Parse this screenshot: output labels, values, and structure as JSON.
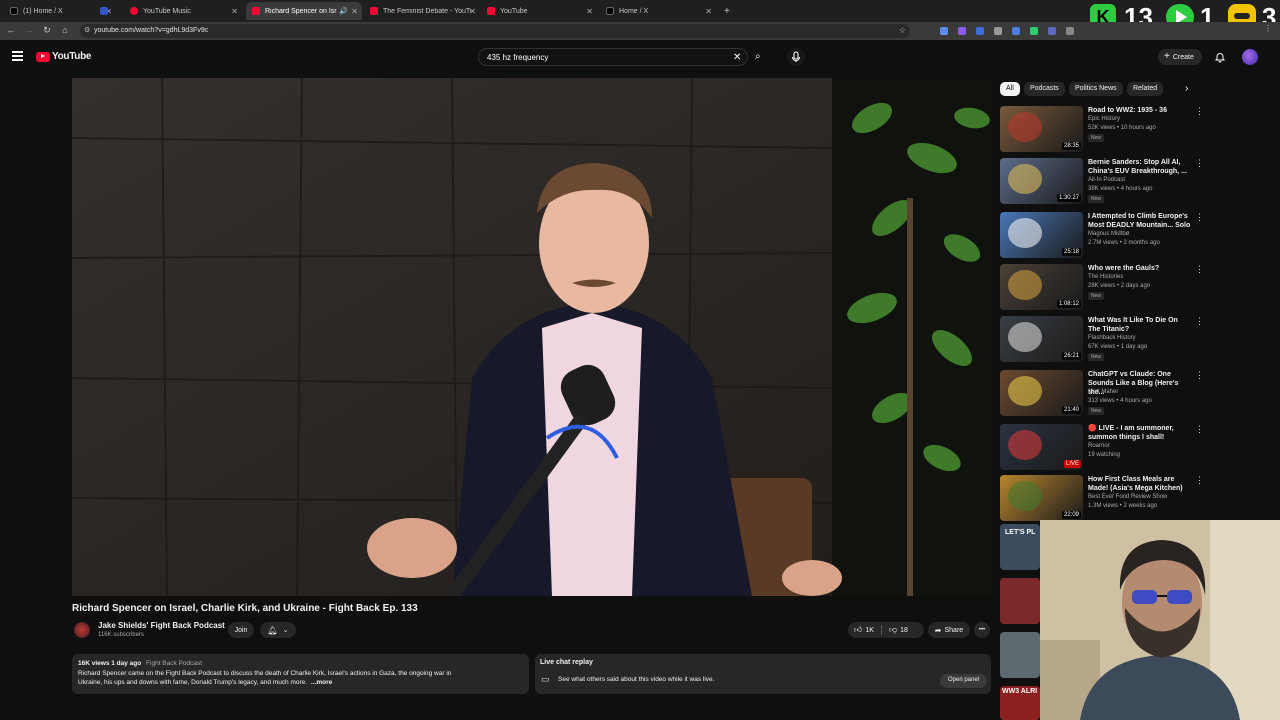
{
  "tabs": [
    {
      "label": "(1) Home / X",
      "fav_color": "#000000"
    },
    {
      "label": "",
      "fav_color": "#1d4ed8"
    },
    {
      "label": "YouTube Music",
      "fav_color": "#ff0033"
    },
    {
      "label": "Richard Spencer on Israel, C",
      "fav_color": "#ff0033"
    },
    {
      "label": "The Feminist Debate - YouTube",
      "fav_color": "#ff0033"
    },
    {
      "label": "YouTube",
      "fav_color": "#ff0033"
    },
    {
      "label": "Home / X",
      "fav_color": "#000000"
    }
  ],
  "new_tab": "+",
  "address": {
    "url": "youtube.com/watch?v=gdhL9d3Fv9c"
  },
  "overlay": {
    "count_a": "13",
    "count_b": "1",
    "count_c": "3"
  },
  "header": {
    "logo_text": "YouTube",
    "search_value": "435 hz frequency",
    "create_label": "Create"
  },
  "chips": [
    "All",
    "Podcasts",
    "Politics News",
    "Related"
  ],
  "recommendations": [
    {
      "title": "Road to WW2: 1935 - 36",
      "channel": "Epic History",
      "meta": "52K views • 10 hours ago",
      "badge": "New",
      "duration": "28:35",
      "thumb_color": "#7a5a3c",
      "thumb_accent": "#c0392b"
    },
    {
      "title": "Bernie Sanders: Stop All AI, China's EUV Breakthrough, ...",
      "channel": "All-In Podcast",
      "meta": "38K views • 4 hours ago",
      "badge": "New",
      "duration": "1:30:27",
      "thumb_color": "#5d6c8a",
      "thumb_accent": "#e8c35a"
    },
    {
      "title": "I Attempted to Climb Europe's Most DEADLY Mountain... Solo",
      "channel": "Magnus Midtbø",
      "meta": "2.7M views • 2 months ago",
      "badge": "",
      "duration": "25:18",
      "thumb_color": "#4a78b8",
      "thumb_accent": "#ffffff"
    },
    {
      "title": "Who were the Gauls?",
      "channel": "The Histories",
      "meta": "28K views • 2 days ago",
      "badge": "New",
      "duration": "1:08:12",
      "thumb_color": "#4a4036",
      "thumb_accent": "#d9a441"
    },
    {
      "title": "What Was It Like To Die On The Titanic?",
      "channel": "Flashback History",
      "meta": "67K views • 1 day ago",
      "badge": "New",
      "duration": "26:21",
      "thumb_color": "#3a3f45",
      "thumb_accent": "#e5e5e5"
    },
    {
      "title": "ChatGPT vs Claude: One Sounds Like a Blog (Here's the...",
      "channel": "Matt Maher",
      "meta": "313 views • 4 hours ago",
      "badge": "New",
      "duration": "21:40",
      "thumb_color": "#6b4a30",
      "thumb_accent": "#f0d24a"
    },
    {
      "title": "🔴 LIVE - I am summoner, summon things I shall!",
      "channel": "Roarrior",
      "meta": "19 watching",
      "badge": "",
      "duration": "LIVE",
      "thumb_color": "#2a3340",
      "thumb_accent": "#e03a3a"
    },
    {
      "title": "How First Class Meals are Made! (Asia's Mega Kitchen)",
      "channel": "Best Ever Food Review Show",
      "meta": "1.3M views • 2 weeks ago",
      "badge": "",
      "duration": "22:09",
      "thumb_color": "#b8862e",
      "thumb_accent": "#3f7a2e"
    }
  ],
  "video": {
    "title": "Richard Spencer on Israel, Charlie Kirk, and Ukraine - Fight Back Ep. 133",
    "channel": "Jake Shields' Fight Back Podcast",
    "subscribers": "116K subscribers",
    "join_label": "Join",
    "likes": "1K",
    "dislikes": "18",
    "share_label": "Share",
    "more": "•••"
  },
  "description": {
    "stats": "16K views  1 day ago",
    "tag": "Fight Back Podcast",
    "text": "Richard Spencer came on the Fight Back Podcast to discuss the death of Charlie Kirk, Israel's actions in Gaza, the ongoing war in Ukraine, his ups and downs with fame, Donald Trump's legacy, and much more.",
    "more_label": "...more"
  },
  "live_chat": {
    "title": "Live chat replay",
    "text": "See what others said about this video while it was live.",
    "button": "Open panel"
  },
  "partial_thumbs": {
    "lets_play": "LET'S PL",
    "ww3": "WW3 ALRI"
  }
}
